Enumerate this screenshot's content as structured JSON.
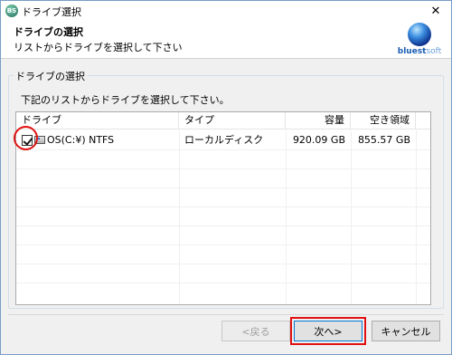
{
  "window": {
    "title": "ドライブ選択",
    "close_glyph": "✕",
    "app_icon_text": "BS"
  },
  "header": {
    "title": "ドライブの選択",
    "subtitle": "リストからドライブを選択して下さい",
    "logo": {
      "brand": "bluest",
      "brand_suffix": "soft"
    }
  },
  "group": {
    "legend": "ドライブの選択",
    "instruction": "下記のリストからドライブを選択して下さい。"
  },
  "listview": {
    "columns": [
      "ドライブ",
      "タイプ",
      "容量",
      "空き領域"
    ],
    "rows": [
      {
        "drive": "OS(C:¥)  NTFS",
        "type": "ローカルディスク",
        "capacity": "920.09 GB",
        "free": "855.57 GB",
        "checked": true
      }
    ]
  },
  "buttons": {
    "back": "<戻る",
    "next": "次へ>",
    "cancel": "キャンセル"
  },
  "colors": {
    "annotation_red": "#e01010",
    "accent_blue": "#0078d7"
  }
}
